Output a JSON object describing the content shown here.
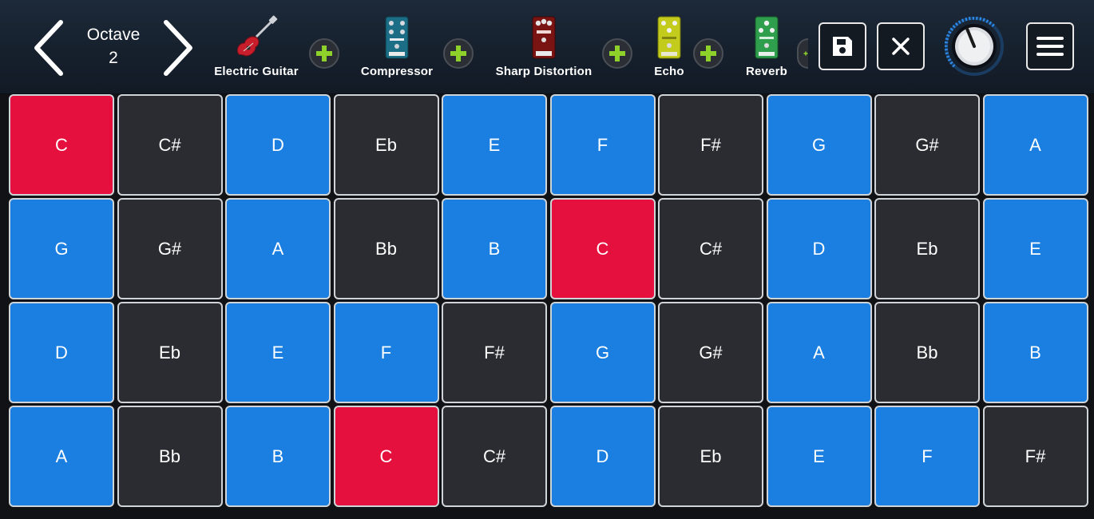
{
  "header": {
    "octave_label": "Octave",
    "octave_value": "2",
    "chain": [
      {
        "name": "Electric Guitar",
        "icon": "electric-guitar-icon"
      },
      {
        "name": "Compressor",
        "icon": "compressor-pedal-icon"
      },
      {
        "name": "Sharp Distortion",
        "icon": "distortion-pedal-icon"
      },
      {
        "name": "Echo",
        "icon": "echo-pedal-icon"
      },
      {
        "name": "Reverb",
        "icon": "reverb-pedal-icon"
      }
    ],
    "icons": {
      "prev": "chevron-left-icon",
      "next": "chevron-right-icon",
      "add": "plus-icon",
      "save": "save-icon",
      "close": "close-icon",
      "volume": "volume-knob-icon",
      "menu": "hamburger-menu-icon"
    }
  },
  "pads": [
    [
      "C",
      "C#",
      "D",
      "Eb",
      "E",
      "F",
      "F#",
      "G",
      "G#",
      "A"
    ],
    [
      "G",
      "G#",
      "A",
      "Bb",
      "B",
      "C",
      "C#",
      "D",
      "Eb",
      "E"
    ],
    [
      "D",
      "Eb",
      "E",
      "F",
      "F#",
      "G",
      "G#",
      "A",
      "Bb",
      "B"
    ],
    [
      "A",
      "Bb",
      "B",
      "C",
      "C#",
      "D",
      "Eb",
      "E",
      "F",
      "F#"
    ]
  ],
  "colors": {
    "natural": "#1a7fe0",
    "accidental": "#2a2c31",
    "root": "#e6103f",
    "add_accent": "#8ed12a"
  }
}
